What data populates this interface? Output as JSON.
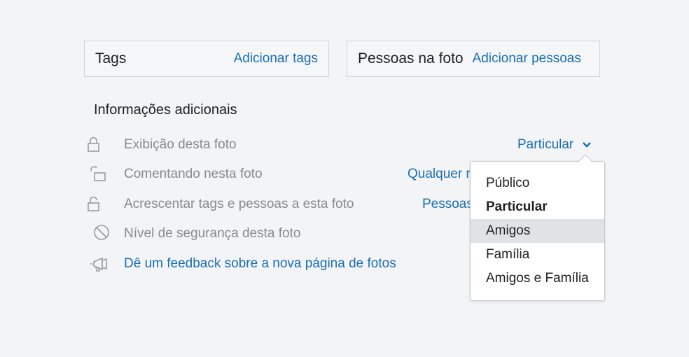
{
  "tags_box": {
    "title": "Tags",
    "link": "Adicionar tags"
  },
  "people_box": {
    "title": "Pessoas na foto",
    "link": "Adicionar pessoas"
  },
  "section": {
    "title": "Informações adicionais"
  },
  "rows": [
    {
      "icon": "lock-icon",
      "label": "Exibição desta foto",
      "value": "Particular"
    },
    {
      "icon": "unlock-icon",
      "label": "Comentando nesta foto",
      "value": "Qualquer r"
    },
    {
      "icon": "lock-open-icon",
      "label": "Acrescentar tags e pessoas a esta foto",
      "value": "Pessoas"
    },
    {
      "icon": "prohibited-icon",
      "label": "Nível de segurança desta foto"
    },
    {
      "icon": "megaphone-icon",
      "label": "Dê um feedback sobre a nova página de fotos"
    }
  ],
  "dropdown": {
    "options": [
      {
        "label": "Público"
      },
      {
        "label": "Particular",
        "selected": true
      },
      {
        "label": "Amigos",
        "hover": true
      },
      {
        "label": "Família"
      },
      {
        "label": "Amigos e Família"
      }
    ]
  },
  "colors": {
    "link": "#1a6fb3",
    "muted": "#898a8d",
    "text": "#212124",
    "background": "#f3f4f6",
    "hover": "#dfe3e6"
  }
}
